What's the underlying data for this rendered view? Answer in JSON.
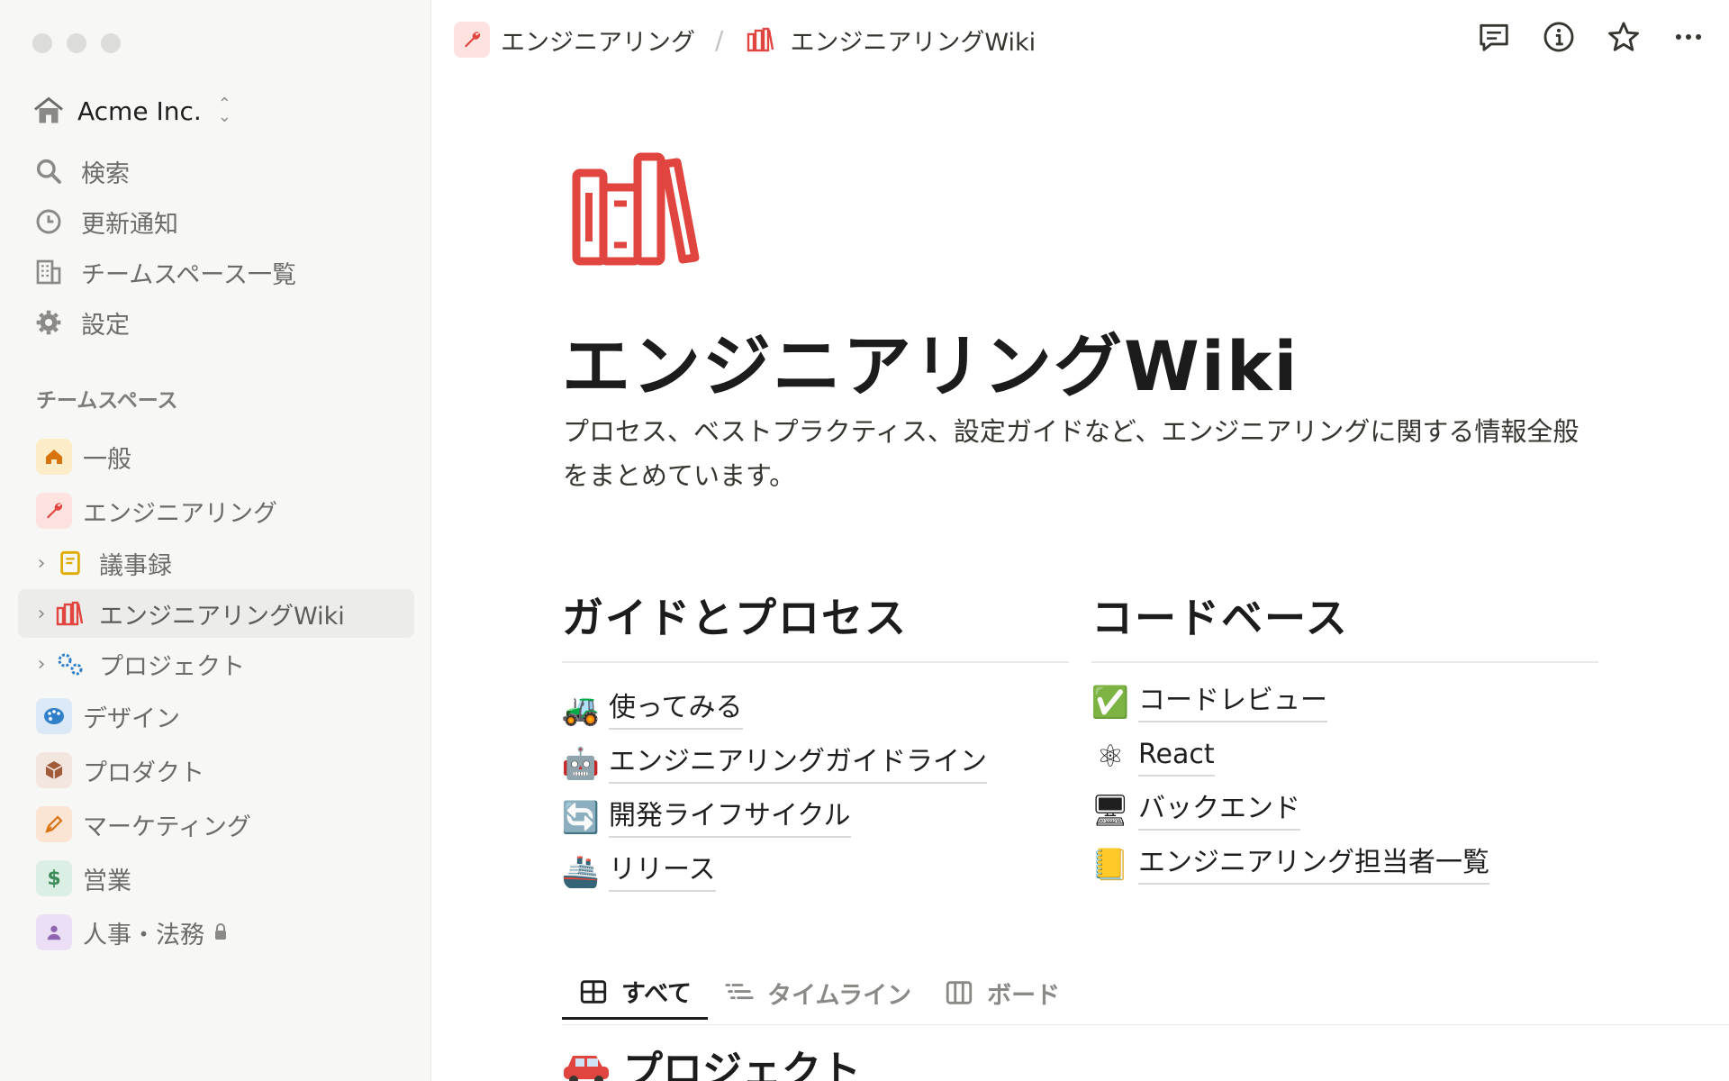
{
  "sidebar": {
    "workspace": "Acme Inc.",
    "nav": [
      {
        "label": "検索",
        "icon": "search-icon"
      },
      {
        "label": "更新通知",
        "icon": "clock-icon"
      },
      {
        "label": "チームスペース一覧",
        "icon": "building-icon"
      },
      {
        "label": "設定",
        "icon": "gear-icon"
      }
    ],
    "section_label": "チームスペース",
    "teamspaces": [
      {
        "label": "一般",
        "icon": "home-icon"
      },
      {
        "label": "エンジニアリング",
        "icon": "wrench-icon"
      },
      {
        "label": "議事録",
        "icon": "notebook-icon"
      },
      {
        "label": "エンジニアリングWiki",
        "icon": "books-icon"
      },
      {
        "label": "プロジェクト",
        "icon": "gears-icon"
      },
      {
        "label": "デザイン",
        "icon": "palette-icon"
      },
      {
        "label": "プロダクト",
        "icon": "package-icon"
      },
      {
        "label": "マーケティング",
        "icon": "pen-icon"
      },
      {
        "label": "営業",
        "icon": "dollar-icon"
      },
      {
        "label": "人事・法務",
        "icon": "person-icon"
      }
    ]
  },
  "breadcrumb": {
    "parent": "エンジニアリング",
    "separator": "/",
    "current": "エンジニアリングWiki"
  },
  "page": {
    "title": "エンジニアリングWiki",
    "description": "プロセス、ベストプラクティス、設定ガイドなど、エンジニアリングに関する情報全般をまとめています。"
  },
  "guides": {
    "heading": "ガイドとプロセス",
    "links": [
      {
        "label": "使ってみる",
        "emoji": "🚜"
      },
      {
        "label": "エンジニアリングガイドライン",
        "emoji": "🤖"
      },
      {
        "label": "開発ライフサイクル",
        "emoji": "🔄"
      },
      {
        "label": "リリース",
        "emoji": "🚢"
      }
    ]
  },
  "codebase": {
    "heading": "コードベース",
    "links": [
      {
        "label": "コードレビュー",
        "emoji": "✅"
      },
      {
        "label": "React",
        "emoji": "⚛"
      },
      {
        "label": "バックエンド",
        "emoji": "🖥"
      },
      {
        "label": "エンジニアリング担当者一覧",
        "emoji": "📒"
      }
    ]
  },
  "tabs": [
    {
      "label": "すべて",
      "icon": "table-icon",
      "active": true
    },
    {
      "label": "タイムライン",
      "icon": "timeline-icon",
      "active": false
    },
    {
      "label": "ボード",
      "icon": "board-icon",
      "active": false
    }
  ],
  "projects_heading": "プロジェクト",
  "colors": {
    "accent_red": "#e0463f",
    "sidebar_bg": "#f7f7f5",
    "active_item_bg": "#ececeb"
  }
}
